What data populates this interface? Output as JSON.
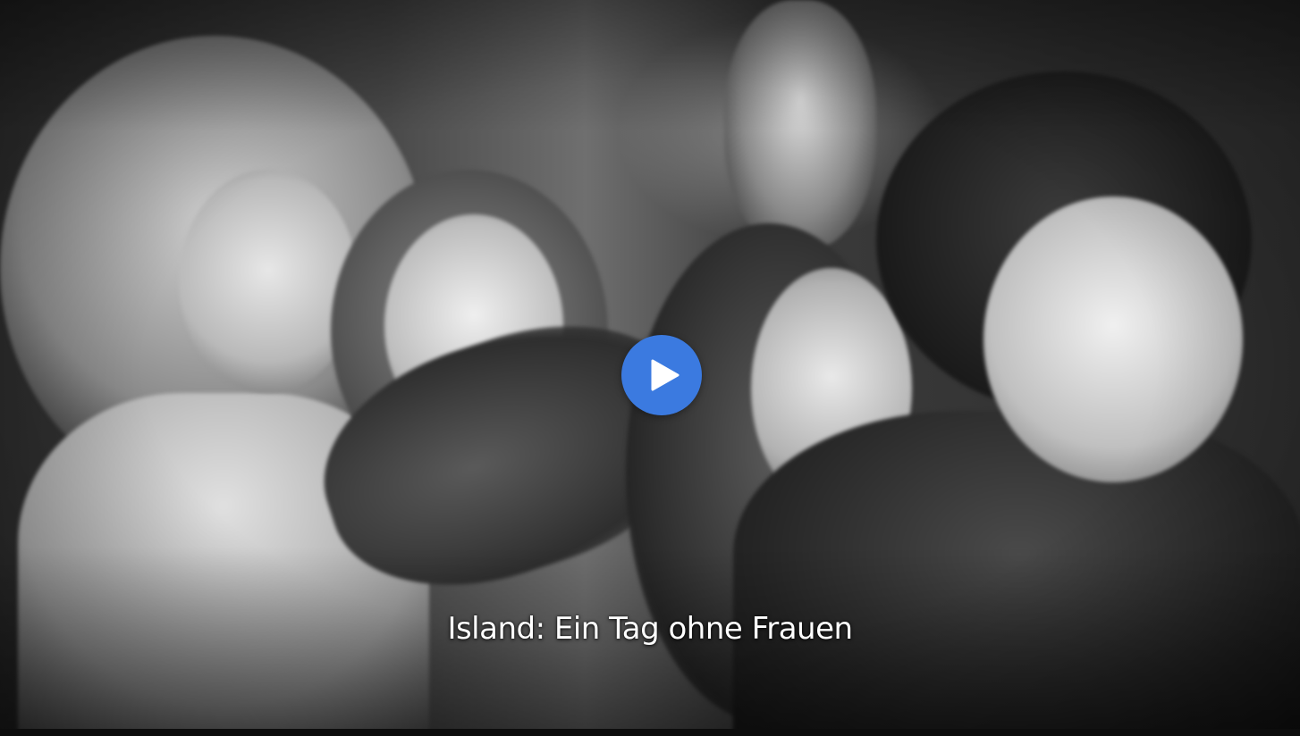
{
  "video": {
    "title": "Island: Ein Tag ohne Frauen",
    "progress_fraction": 0
  },
  "controls": {
    "play_icon": "play-icon"
  },
  "colors": {
    "accent": "#3b7ae0",
    "title_text": "#ffffff"
  }
}
